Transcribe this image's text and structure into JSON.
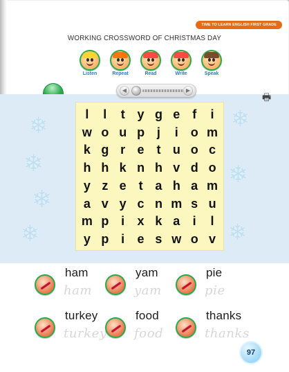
{
  "header": {
    "tag_text": "TIME TO LEARN ENGLISH FIRST GRADE",
    "title": "WORKING CROSSWORD OF CHRISTMAS DAY"
  },
  "skills": [
    {
      "label": "Listen",
      "icon": "listen-icon",
      "hair_color": "#ffd32a"
    },
    {
      "label": "Repeat",
      "icon": "repeat-icon",
      "hair_color": "#ff6a00"
    },
    {
      "label": "Read",
      "icon": "read-icon",
      "hair_color": "#ff3b3b"
    },
    {
      "label": "Write",
      "icon": "write-icon",
      "hair_color": "#ff3b3b"
    },
    {
      "label": "Speak",
      "icon": "speak-icon",
      "hair_color": "#6a3d1f"
    }
  ],
  "audio": {
    "play_icon": "play-icon",
    "position_icon": "scrubber-knob-icon",
    "end_icon": "end-icon"
  },
  "toolbar": {
    "print_icon": "printer-icon"
  },
  "puzzle": {
    "grid": [
      [
        "l",
        "l",
        "t",
        "y",
        "g",
        "e",
        "f",
        "i"
      ],
      [
        "w",
        "o",
        "u",
        "p",
        "j",
        "i",
        "o",
        "m"
      ],
      [
        "k",
        "g",
        "r",
        "e",
        "t",
        "u",
        "o",
        "c"
      ],
      [
        "h",
        "h",
        "k",
        "n",
        "h",
        "v",
        "d",
        "o"
      ],
      [
        "y",
        "z",
        "e",
        "t",
        "a",
        "h",
        "a",
        "m"
      ],
      [
        "a",
        "v",
        "y",
        "c",
        "n",
        "m",
        "s",
        "u"
      ],
      [
        "m",
        "p",
        "i",
        "x",
        "k",
        "a",
        "i",
        "l"
      ],
      [
        "y",
        "p",
        "i",
        "e",
        "s",
        "w",
        "o",
        "v"
      ]
    ]
  },
  "word_bank": [
    {
      "print": "ham",
      "trace": "ham",
      "icon": "pencil-icon"
    },
    {
      "print": "yam",
      "trace": "yam",
      "icon": "pencil-icon"
    },
    {
      "print": "pie",
      "trace": "pie",
      "icon": "pencil-icon"
    },
    {
      "print": "turkey",
      "trace": "turkey",
      "icon": "pencil-icon"
    },
    {
      "print": "food",
      "trace": "food",
      "icon": "pencil-icon"
    },
    {
      "print": "thanks",
      "trace": "thanks",
      "icon": "pencil-icon"
    }
  ],
  "footer": {
    "page_number": "97"
  }
}
